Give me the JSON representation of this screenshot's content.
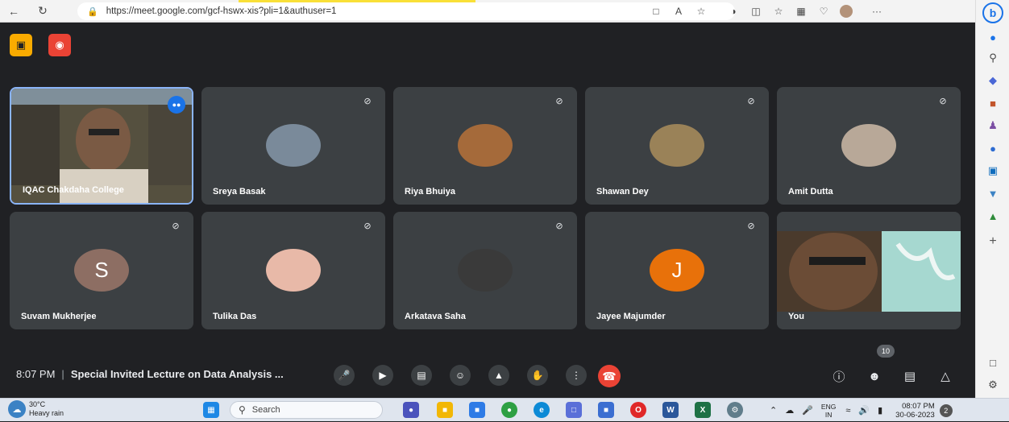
{
  "browser": {
    "url": "https://meet.google.com/gcf-hswx-xis?pli=1&authuser=1",
    "nav": {
      "back": "←",
      "reload": "↻"
    },
    "toolbar_icons": [
      "camera-blocked-icon",
      "read-aloud-icon",
      "favorite-star-icon",
      "extensions-icon",
      "split-screen-icon",
      "favorites-icon",
      "collections-icon",
      "browser-essentials-icon",
      "profile-avatar-icon",
      "more-icon"
    ],
    "more_label": "···"
  },
  "sidebar": {
    "items": [
      "bell-icon",
      "search-icon",
      "shopping-tag-icon",
      "briefcase-icon",
      "games-icon",
      "office-icon",
      "outlook-icon",
      "drop-icon",
      "tree-icon"
    ],
    "add_label": "+"
  },
  "meet": {
    "tiles": [
      {
        "name": "IQAC Chakdaha College",
        "kind": "video",
        "speaking": true,
        "muted": false
      },
      {
        "name": "Sreya Basak",
        "kind": "photo",
        "muted": true,
        "avatar_color": "#7a8a9a"
      },
      {
        "name": "Riya Bhuiya",
        "kind": "photo",
        "muted": true,
        "avatar_color": "#a56a3a"
      },
      {
        "name": "Shawan Dey",
        "kind": "photo",
        "muted": true,
        "avatar_color": "#9a8258"
      },
      {
        "name": "Amit Dutta",
        "kind": "photo",
        "muted": true,
        "avatar_color": "#b8a898"
      },
      {
        "name": "Suvam Mukherjee",
        "kind": "letter",
        "letter": "S",
        "muted": true,
        "avatar_color": "#8d6e63"
      },
      {
        "name": "Tulika Das",
        "kind": "photo",
        "muted": true,
        "avatar_color": "#e8b9a8"
      },
      {
        "name": "Arkatava Saha",
        "kind": "photo",
        "muted": true,
        "avatar_color": "#3a3a3a"
      },
      {
        "name": "Jayee Majumder",
        "kind": "letter",
        "letter": "J",
        "muted": true,
        "avatar_color": "#e8710a"
      },
      {
        "name": "You",
        "kind": "video",
        "muted": false
      }
    ],
    "time": "8:07 PM",
    "meeting_title": "Special Invited Lecture on Data Analysis ...",
    "participant_count": "10",
    "colors": {
      "end_call": "#ea4335",
      "speaking_border": "#8ab4f8",
      "record_badge": "#ea4335",
      "cam_badge": "#f9ab00"
    }
  },
  "taskbar": {
    "weather_temp": "30°C",
    "weather_desc": "Heavy rain",
    "search_placeholder": "Search",
    "lang_top": "ENG",
    "lang_bottom": "IN",
    "clock_time": "08:07 PM",
    "clock_date": "30-06-2023",
    "notifications": "2"
  }
}
